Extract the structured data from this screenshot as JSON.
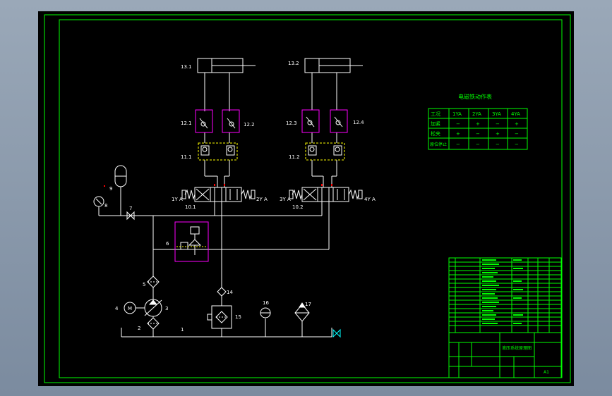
{
  "colors": {
    "background": "#000000",
    "frame": "#00ff00",
    "line": "#ffffff",
    "valve": "#ffff00",
    "check_box": "#ff00ff",
    "marker": "#ff0000",
    "desktop": "#8c9bad"
  },
  "labels": {
    "cyl_1": "13.1",
    "cyl_2": "13.2",
    "chk_1": "12.1",
    "chk_2": "12.2",
    "chk_3": "12.3",
    "chk_4": "12.4",
    "hydlock_1": "11.1",
    "hydlock_2": "11.2",
    "valve_1": "10.1",
    "valve_2": "10.2",
    "sol_1": "1Y A",
    "sol_2": "2Y A",
    "sol_3": "3Y A",
    "sol_4": "4Y A",
    "relief": "6",
    "filter_5": "5",
    "motor": "4",
    "pump": "3",
    "strainer": "2",
    "tank": "1",
    "accumulator": "9",
    "gauge": "8",
    "shutoff": "7",
    "filter_14": "14",
    "filter_15": "15",
    "thermo": "16",
    "cooler": "17"
  },
  "solenoid_table": {
    "title": "电磁铁动作表",
    "headers": [
      "工况",
      "1YA",
      "2YA",
      "3YA",
      "4YA"
    ],
    "rows": [
      [
        "加紧",
        "−",
        "+",
        "−",
        "+"
      ],
      [
        "松夹",
        "+",
        "−",
        "+",
        "−"
      ],
      [
        "原位停止",
        "−",
        "−",
        "−",
        "−"
      ]
    ]
  },
  "title_block": {
    "title_text": "液压系统原理图",
    "sheet": "A1"
  }
}
